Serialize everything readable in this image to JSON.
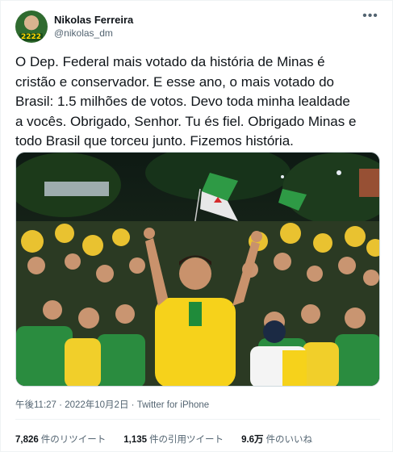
{
  "author": {
    "name": "Nikolas Ferreira",
    "handle": "@nikolas_dm",
    "avatar_badge": "2222"
  },
  "tweet": {
    "text": "O Dep. Federal mais votado da história de Minas é\ncristão e conservador. E esse ano, o mais votado do\nBrasil: 1.5 milhões de votos. Devo toda minha lealdade\na vocês. Obrigado, Senhor. Tu és fiel. Obrigado Minas e\ntodo Brasil que torceu junto. Fizemos história.",
    "time": "午後11:27",
    "date": "2022年10月2日",
    "separator": "·",
    "source": "Twitter for iPhone"
  },
  "stats": {
    "retweets_count": "7,826",
    "retweets_label": "件のリツイート",
    "quotes_count": "1,135",
    "quotes_label": "件の引用ツイート",
    "likes_count": "9.6万",
    "likes_label": "件のいいね"
  },
  "icons": {
    "more": "more-dots-icon"
  },
  "colors": {
    "text": "#0f1419",
    "secondary": "#536471",
    "jersey": "#f6d21b",
    "green": "#1f8b3a",
    "border": "#eff3f4"
  }
}
